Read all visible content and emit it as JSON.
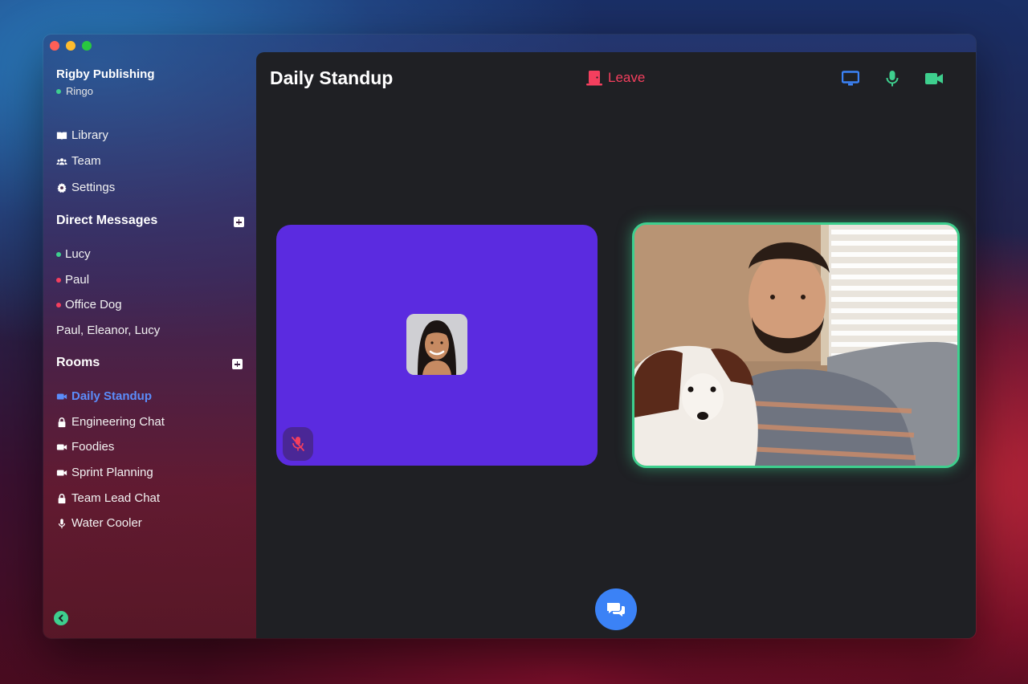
{
  "workspace": {
    "name": "Rigby Publishing",
    "user": "Ringo"
  },
  "nav": [
    {
      "label": "Library",
      "icon": "book-icon"
    },
    {
      "label": "Team",
      "icon": "users-icon"
    },
    {
      "label": "Settings",
      "icon": "gear-icon"
    }
  ],
  "direct_messages": {
    "heading": "Direct Messages",
    "items": [
      {
        "label": "Lucy",
        "status": "online"
      },
      {
        "label": "Paul",
        "status": "busy"
      },
      {
        "label": "Office Dog",
        "status": "busy"
      },
      {
        "label": "Paul, Eleanor, Lucy",
        "status": ""
      }
    ]
  },
  "rooms": {
    "heading": "Rooms",
    "items": [
      {
        "label": "Daily Standup",
        "icon": "video-icon",
        "active": true
      },
      {
        "label": "Engineering Chat",
        "icon": "lock-icon"
      },
      {
        "label": "Foodies",
        "icon": "video-icon"
      },
      {
        "label": "Sprint Planning",
        "icon": "video-icon"
      },
      {
        "label": "Team Lead Chat",
        "icon": "lock-icon"
      },
      {
        "label": "Water Cooler",
        "icon": "mic-icon"
      }
    ]
  },
  "call": {
    "title": "Daily Standup",
    "leave_label": "Leave"
  },
  "colors": {
    "accent_blue": "#3b82f6",
    "active_green": "#3ecf8e",
    "leave_red": "#f43f5e",
    "tile_purple": "#5b2be0"
  }
}
